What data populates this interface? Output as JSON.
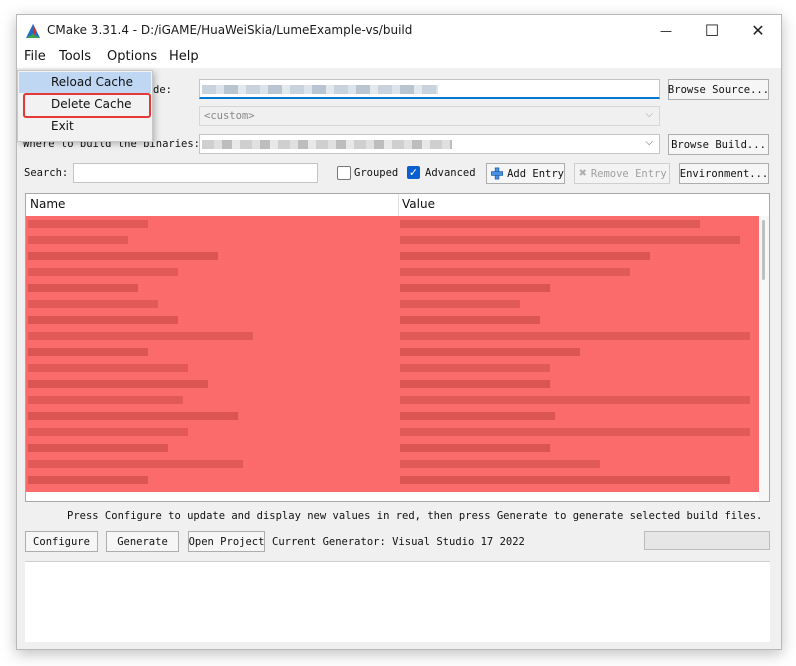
{
  "window": {
    "title": "CMake 3.31.4 - D:/iGAME/HuaWeiSkia/LumeExample-vs/build",
    "minimize_glyph": "—",
    "maximize_glyph": "☐",
    "close_glyph": "✕"
  },
  "menubar": {
    "file": "File",
    "tools": "Tools",
    "options": "Options",
    "help": "Help"
  },
  "file_menu": {
    "items": [
      "Reload Cache",
      "Delete Cache",
      "Exit"
    ]
  },
  "source": {
    "label_fragment": "de:",
    "browse_button": "Browse Source..."
  },
  "preset": {
    "value": "<custom>"
  },
  "binaries": {
    "label": "Where to build the binaries:",
    "browse_button": "Browse Build..."
  },
  "search": {
    "label": "Search:",
    "value": ""
  },
  "toolbar": {
    "grouped_label": "Grouped",
    "grouped_checked": false,
    "advanced_label": "Advanced",
    "advanced_checked": true,
    "add_entry": "Add Entry",
    "remove_entry": "Remove Entry",
    "environment": "Environment..."
  },
  "table": {
    "columns": [
      "Name",
      "Value"
    ]
  },
  "status": {
    "message": "Press Configure to update and display new values in red, then press Generate to generate selected build files."
  },
  "actions": {
    "configure": "Configure",
    "generate": "Generate",
    "open_project": "Open Project",
    "current_generator": "Current Generator: Visual Studio 17 2022"
  },
  "colors": {
    "accent": "#0078d4",
    "highlight_box": "#e53935",
    "new_value_row": "#fb6b6b"
  }
}
